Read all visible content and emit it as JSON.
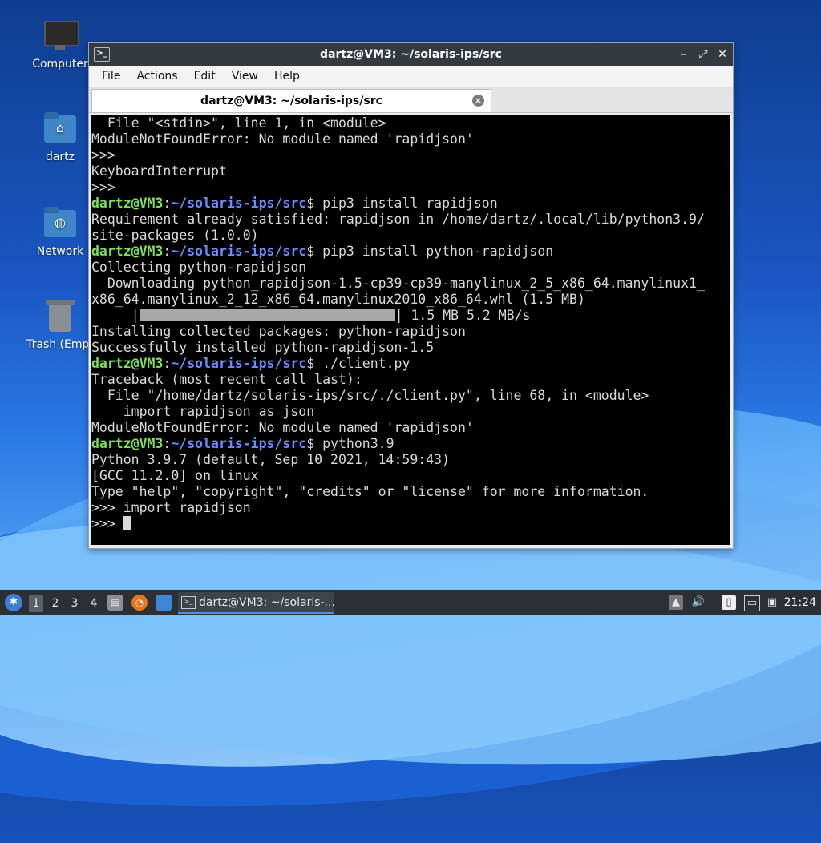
{
  "desktop": {
    "icons": [
      {
        "label": "Computer"
      },
      {
        "label": "dartz"
      },
      {
        "label": "Network"
      },
      {
        "label": "Trash (Empt"
      }
    ]
  },
  "window": {
    "title": "dartz@VM3: ~/solaris-ips/src",
    "buttons": {
      "minimize": "–",
      "maximize": "⤢",
      "close": "✕"
    },
    "menu": [
      "File",
      "Actions",
      "Edit",
      "View",
      "Help"
    ],
    "tab_title": "dartz@VM3: ~/solaris-ips/src",
    "tab_close": "×"
  },
  "terminal": {
    "prompt_user": "dartz@VM3",
    "prompt_colon": ":",
    "prompt_path": "~/solaris-ips/src",
    "prompt_dollar": "$",
    "lines": {
      "l1": "  File \"<stdin>\", line 1, in <module>",
      "l2": "ModuleNotFoundError: No module named 'rapidjson'",
      "l3": ">>>",
      "l4": "KeyboardInterrupt",
      "l5": ">>>",
      "cmd1": " pip3 install rapidjson",
      "l7": "Requirement already satisfied: rapidjson in /home/dartz/.local/lib/python3.9/",
      "l8": "site-packages (1.0.0)",
      "cmd2": " pip3 install python-rapidjson",
      "l10": "Collecting python-rapidjson",
      "l11": "  Downloading python_rapidjson-1.5-cp39-cp39-manylinux_2_5_x86_64.manylinux1_",
      "l12": "x86_64.manylinux_2_12_x86_64.manylinux2010_x86_64.whl (1.5 MB)",
      "l13_prefix": "     |",
      "l13_suffix": "| 1.5 MB 5.2 MB/s",
      "l14": "Installing collected packages: python-rapidjson",
      "l15": "Successfully installed python-rapidjson-1.5",
      "cmd3": " ./client.py",
      "l17": "Traceback (most recent call last):",
      "l18": "  File \"/home/dartz/solaris-ips/src/./client.py\", line 68, in <module>",
      "l19": "    import rapidjson as json",
      "l20": "ModuleNotFoundError: No module named 'rapidjson'",
      "cmd4": " python3.9",
      "l22": "Python 3.9.7 (default, Sep 10 2021, 14:59:43)",
      "l23": "[GCC 11.2.0] on linux",
      "l24": "Type \"help\", \"copyright\", \"credits\" or \"license\" for more information.",
      "l25": ">>> import rapidjson",
      "l26": ">>> "
    },
    "download_progress": 1.0
  },
  "taskbar": {
    "workspaces": [
      "1",
      "2",
      "3",
      "4"
    ],
    "active_workspace": "1",
    "task_label": "dartz@VM3: ~/solaris-...",
    "clock": "21:24",
    "accent": "#4f8fe6"
  }
}
